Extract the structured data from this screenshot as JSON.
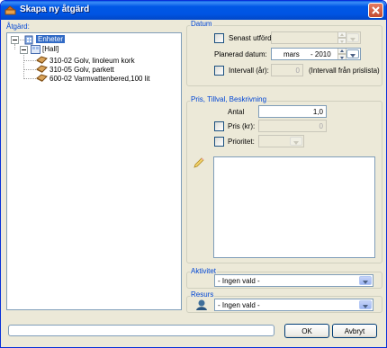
{
  "window": {
    "title": "Skapa ny åtgärd"
  },
  "tree": {
    "label": "Åtgärd:",
    "root": "Enheter",
    "group": "[Hall]",
    "items": [
      "310-02 Golv, linoleum kork",
      "310-05 Golv, parkett",
      "600-02 Varmvattenbered,100 lit"
    ]
  },
  "datum": {
    "title": "Datum",
    "senast_label": "Senast utförd:",
    "senast_value": "",
    "planerad_label": "Planerad datum:",
    "planerad_month": "mars",
    "planerad_year": "- 2010",
    "intervall_label": "Intervall (år):",
    "intervall_value": "0",
    "intervall_note": "(Intervall från prislista)"
  },
  "pris": {
    "title": "Pris, Tillval, Beskrivning",
    "antal_label": "Antal",
    "antal_value": "1,0",
    "pris_label": "Pris (kr):",
    "pris_value": "0",
    "prioritet_label": "Prioritet:",
    "prioritet_value": "",
    "beskrivning": ""
  },
  "aktivitet": {
    "title": "Aktivitet",
    "value": "- Ingen vald -"
  },
  "resurs": {
    "title": "Resurs",
    "value": "- Ingen vald -"
  },
  "buttons": {
    "ok": "OK",
    "cancel": "Avbryt"
  },
  "status": {
    "progress": 0
  },
  "colors": {
    "titlebar": "#0054e3",
    "group_title": "#0046d5",
    "selection": "#316ac5",
    "dialog_bg": "#ece9d8"
  },
  "icons": [
    "tool-icon",
    "close-icon",
    "building-icon",
    "room-icon",
    "work-item-icon",
    "note-icon",
    "person-icon"
  ]
}
